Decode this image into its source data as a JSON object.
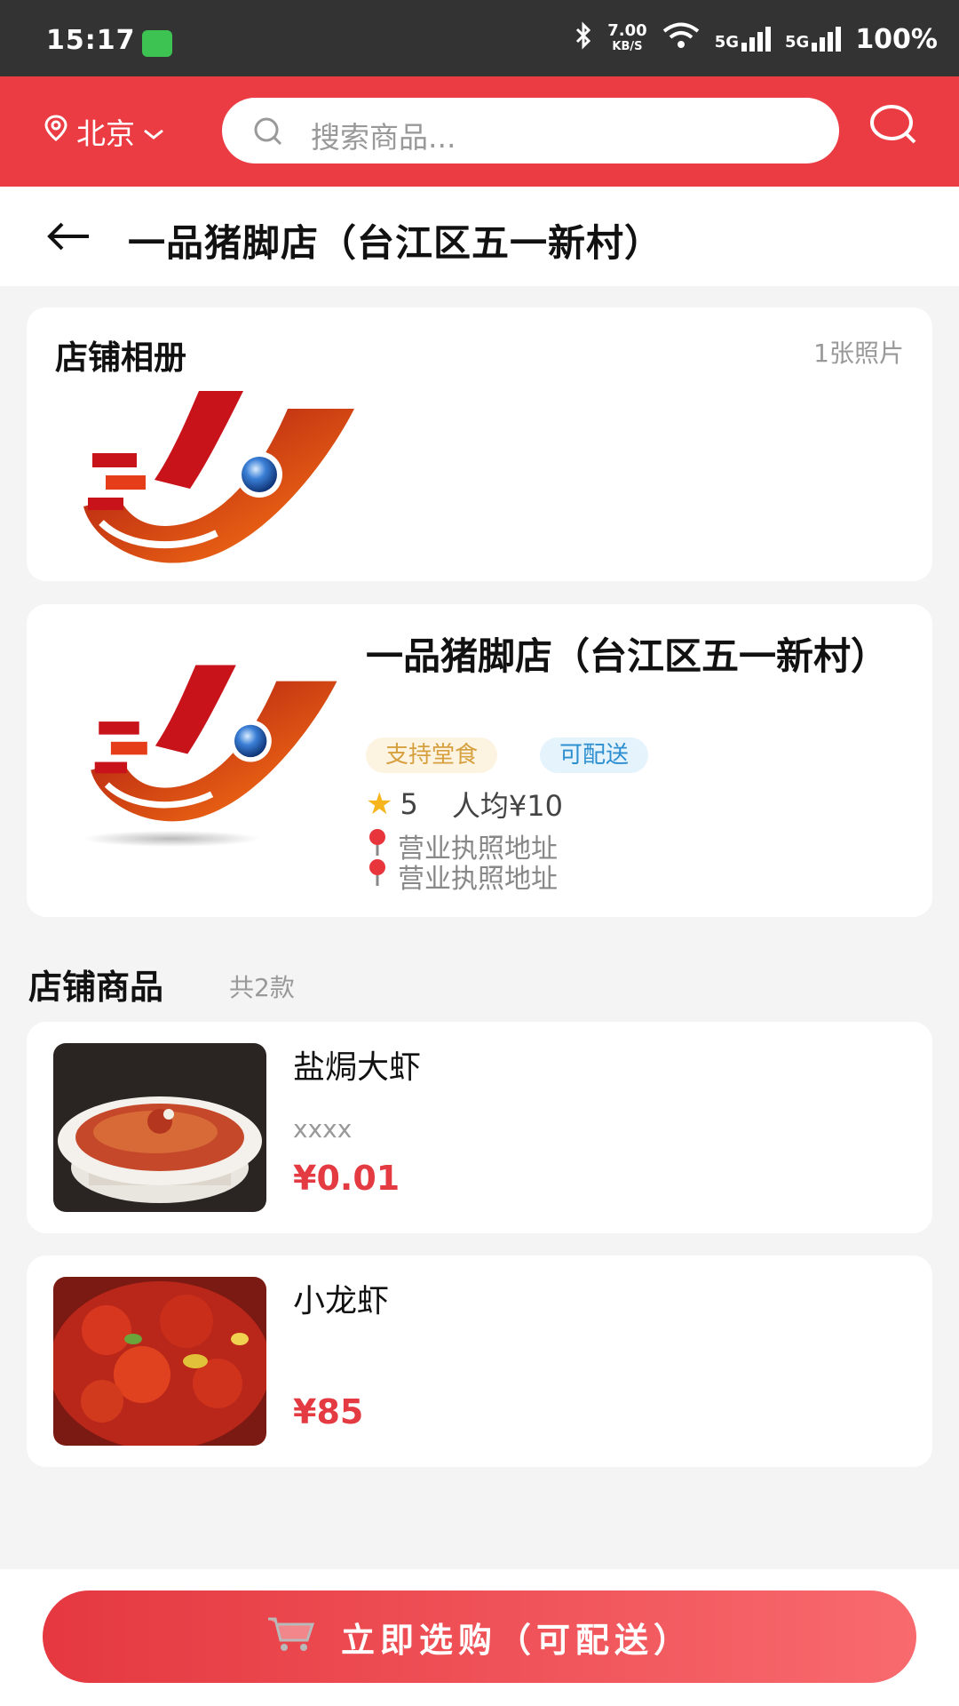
{
  "status_bar": {
    "time": "15:17",
    "speed_value": "7.00",
    "speed_unit": "KB/S",
    "net1": "5G",
    "net2": "5G",
    "battery": "100%"
  },
  "header": {
    "city": "北京",
    "search_placeholder": "搜索商品..."
  },
  "page": {
    "title": "一品猪脚店（台江区五一新村）"
  },
  "album": {
    "title": "店铺相册",
    "count": "1张照片"
  },
  "store": {
    "name": "一品猪脚店（台江区五一新村）",
    "tags": [
      "支持堂食",
      "可配送"
    ],
    "rating": "5",
    "avg_price": "人均¥10",
    "addresses": [
      "营业执照地址",
      "营业执照地址"
    ]
  },
  "products_section": {
    "title": "店铺商品",
    "count": "共2款"
  },
  "products": [
    {
      "name": "盐焗大虾",
      "desc": "xxxx",
      "price": "¥0.01"
    },
    {
      "name": "小龙虾",
      "desc": "",
      "price": "¥85"
    }
  ],
  "bottom": {
    "buy_label": "立即选购（可配送）"
  },
  "colors": {
    "brand": "#ec3c43",
    "price": "#e43a42",
    "tag_dine": "#d6a03e",
    "tag_delivery": "#2d8fd0"
  }
}
